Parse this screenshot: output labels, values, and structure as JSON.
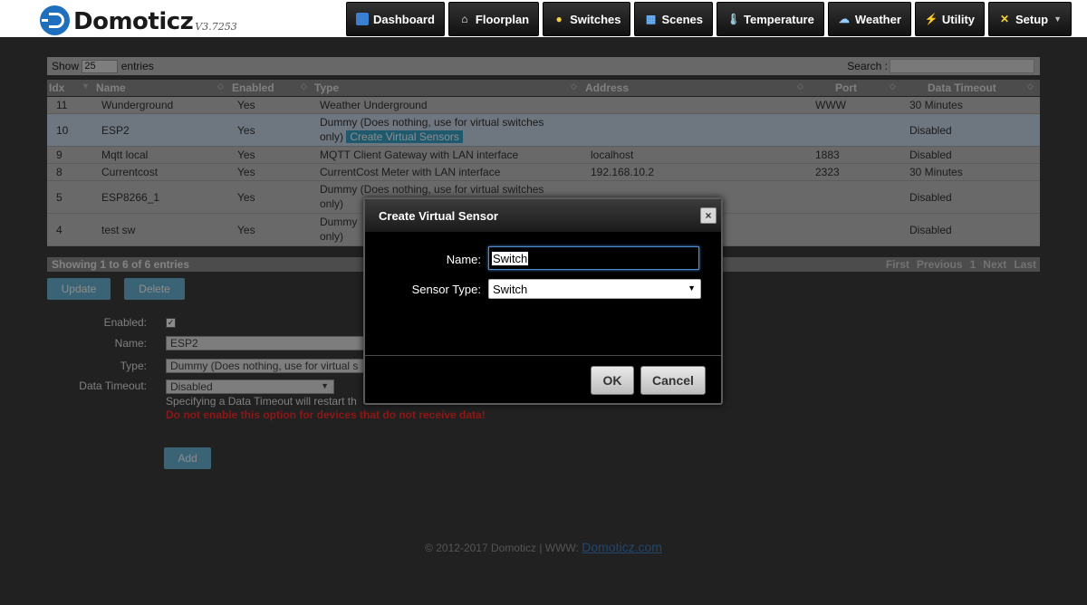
{
  "brand": {
    "name": "Domoticz",
    "version": "V3.7253"
  },
  "nav": [
    {
      "label": "Dashboard"
    },
    {
      "label": "Floorplan"
    },
    {
      "label": "Switches"
    },
    {
      "label": "Scenes"
    },
    {
      "label": "Temperature"
    },
    {
      "label": "Weather"
    },
    {
      "label": "Utility"
    },
    {
      "label": "Setup"
    }
  ],
  "table": {
    "show_prefix": "Show",
    "show_value": "25",
    "show_suffix": "entries",
    "search_label": "Search :",
    "columns": [
      "Idx",
      "Name",
      "Enabled",
      "Type",
      "Address",
      "Port",
      "Data Timeout"
    ],
    "rows": [
      {
        "idx": "11",
        "name": "Wunderground",
        "enabled": "Yes",
        "type": "Weather Underground",
        "address": "",
        "port": "WWW",
        "timeout": "30 Minutes"
      },
      {
        "idx": "10",
        "name": "ESP2",
        "enabled": "Yes",
        "type": "Dummy (Does nothing, use for virtual switches",
        "type2": "only)",
        "action": "Create Virtual Sensors",
        "address": "",
        "port": "",
        "timeout": "Disabled"
      },
      {
        "idx": "9",
        "name": "Mqtt local",
        "enabled": "Yes",
        "type": "MQTT Client Gateway with LAN interface",
        "address": "localhost",
        "port": "1883",
        "timeout": "Disabled"
      },
      {
        "idx": "8",
        "name": "Currentcost",
        "enabled": "Yes",
        "type": "CurrentCost Meter with LAN interface",
        "address": "192.168.10.2",
        "port": "2323",
        "timeout": "30 Minutes"
      },
      {
        "idx": "5",
        "name": "ESP8266_1",
        "enabled": "Yes",
        "type": "Dummy (Does nothing, use for virtual switches",
        "type2": "only)",
        "address": "",
        "port": "",
        "timeout": "Disabled"
      },
      {
        "idx": "4",
        "name": "test sw",
        "enabled": "Yes",
        "type": "Dummy",
        "type2": "only)",
        "address": "",
        "port": "",
        "timeout": "Disabled"
      }
    ],
    "info": "Showing 1 to 6 of 6 entries",
    "pager": [
      "First",
      "Previous",
      "1",
      "Next",
      "Last"
    ]
  },
  "actions": {
    "update": "Update",
    "delete": "Delete",
    "add": "Add"
  },
  "form": {
    "enabled_label": "Enabled:",
    "name_label": "Name:",
    "name_value": "ESP2",
    "type_label": "Type:",
    "type_value": "Dummy (Does nothing, use for virtual s",
    "timeout_label": "Data Timeout:",
    "timeout_value": "Disabled",
    "timeout_note": "Specifying a Data Timeout will restart th",
    "warning": "Do not enable this option for devices that do not receive data!"
  },
  "footer": {
    "text": "© 2012-2017 Domoticz | WWW:",
    "link": "Domoticz.com"
  },
  "modal": {
    "title": "Create Virtual Sensor",
    "name_label": "Name:",
    "name_value": "Switch",
    "type_label": "Sensor Type:",
    "type_value": "Switch",
    "ok": "OK",
    "cancel": "Cancel"
  }
}
